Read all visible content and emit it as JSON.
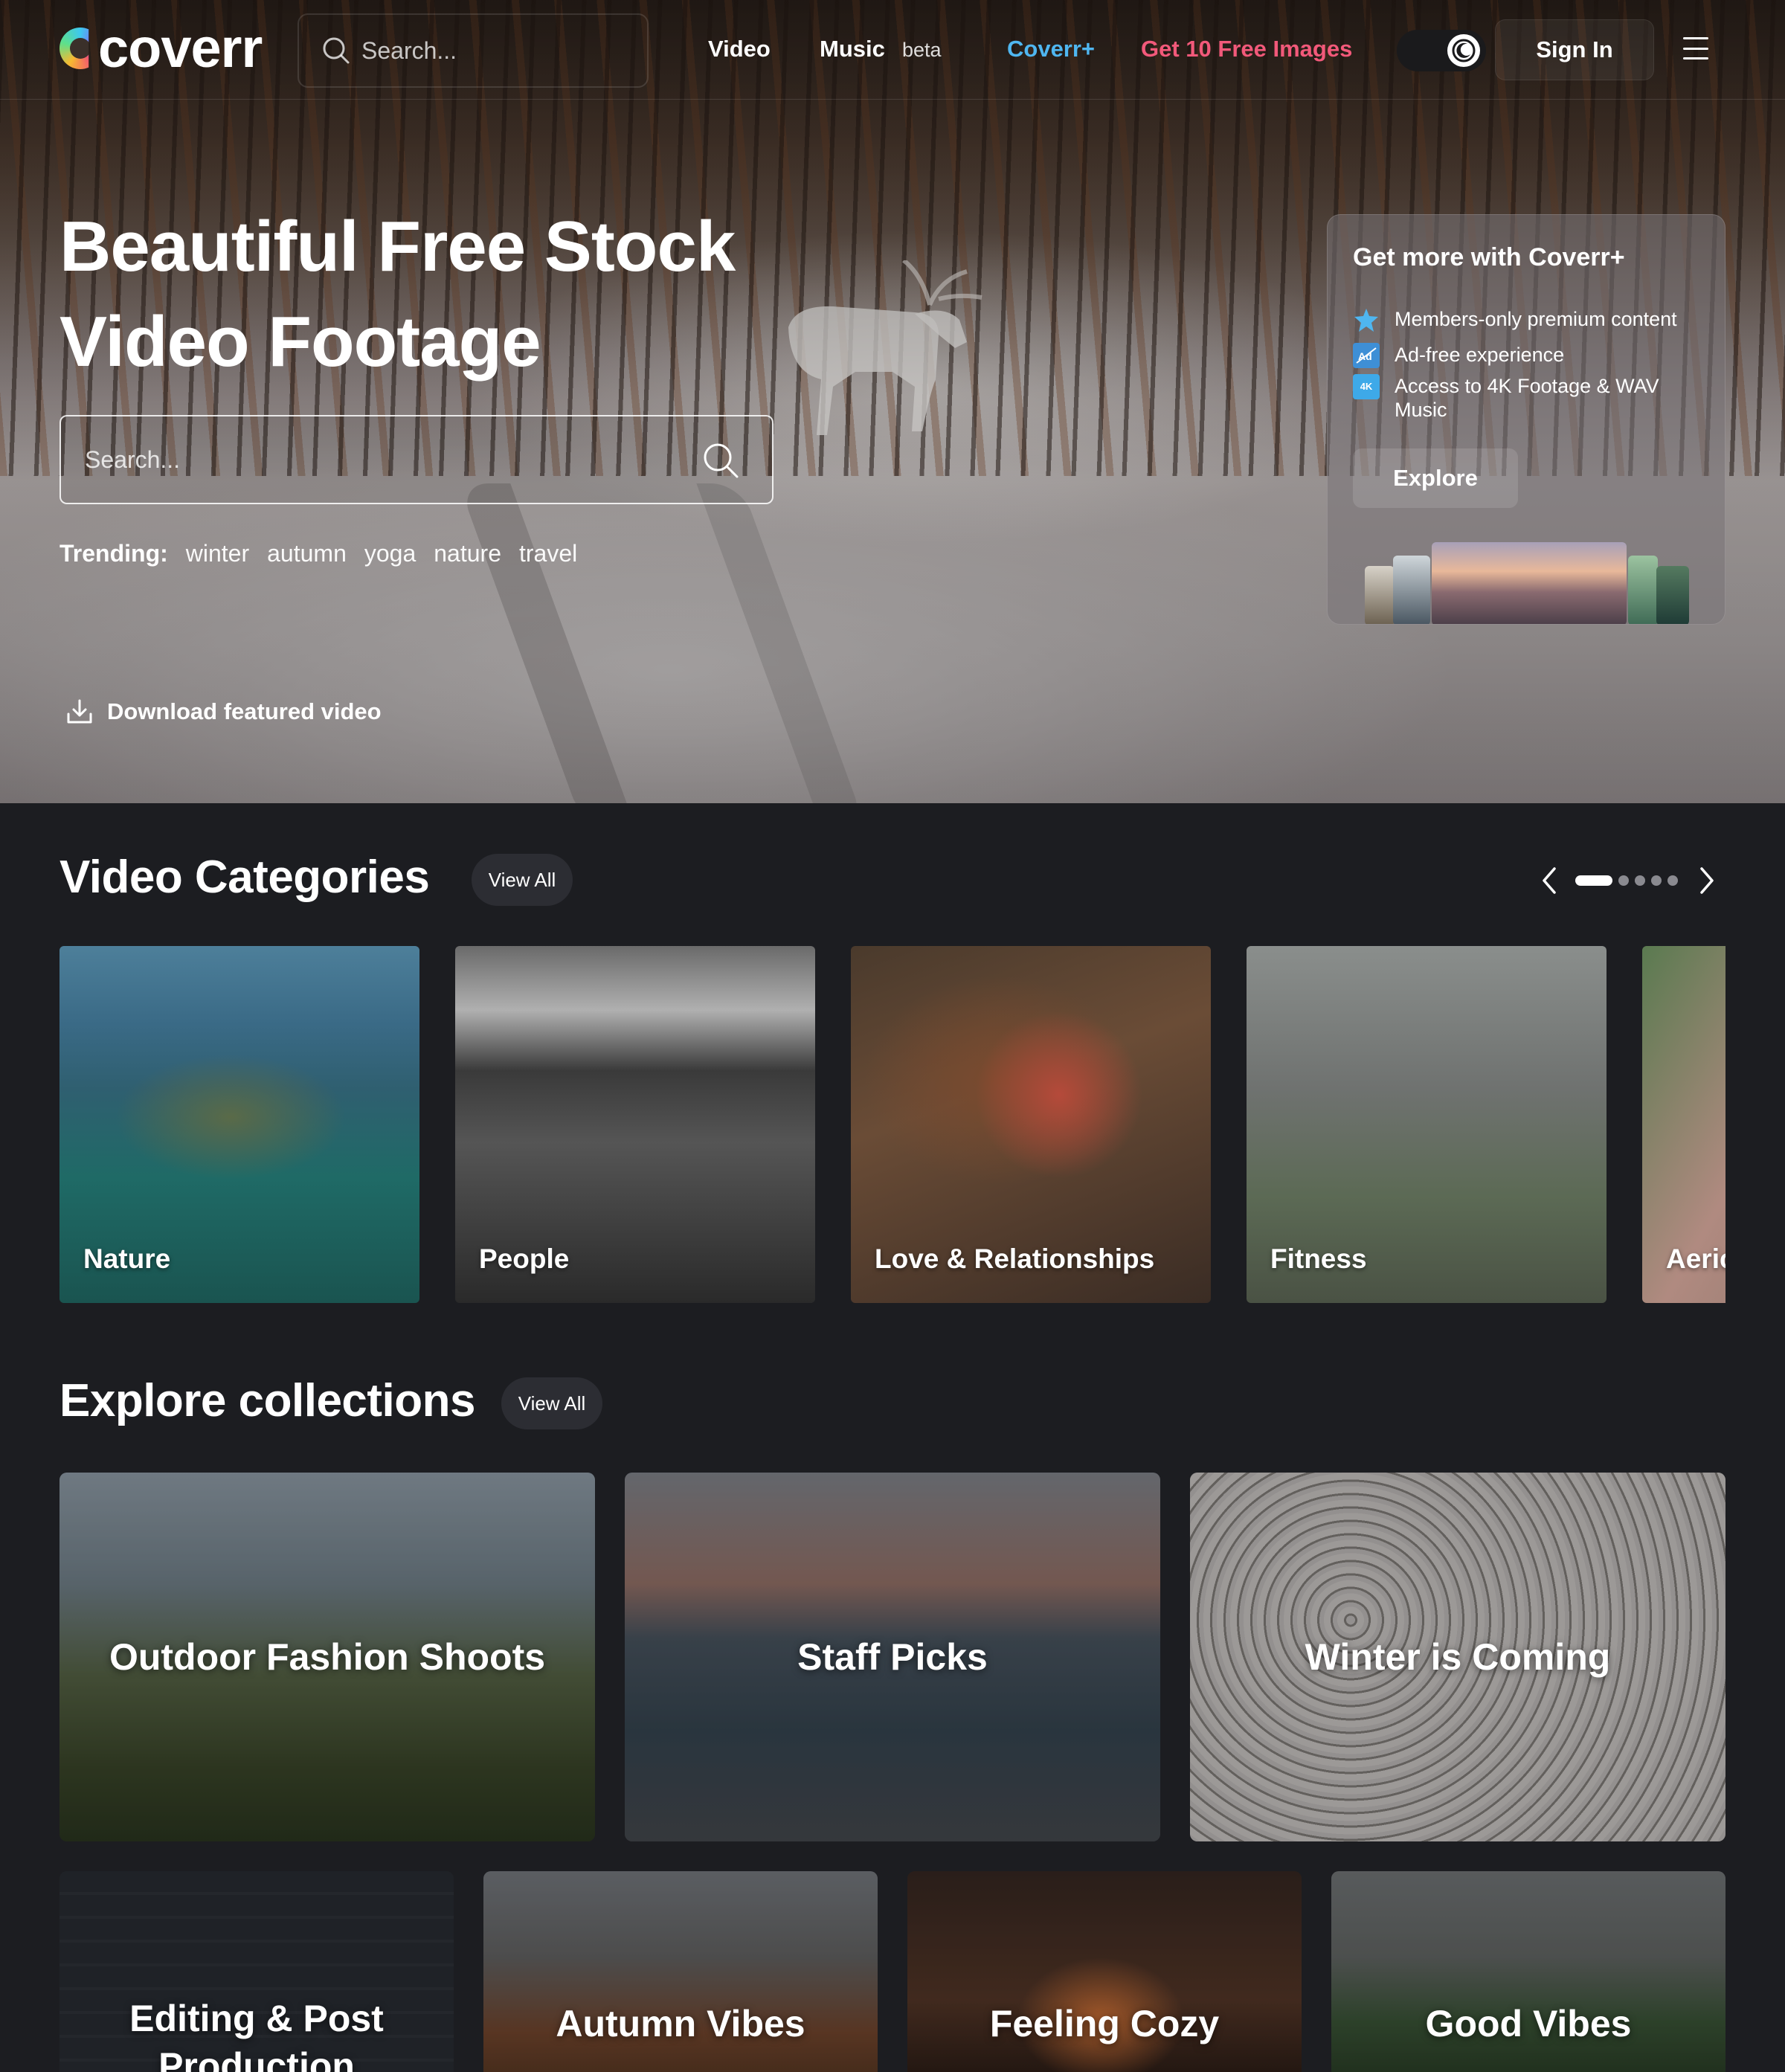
{
  "nav": {
    "logo_text": "coverr",
    "search_placeholder": "Search...",
    "links": {
      "video": "Video",
      "music": "Music",
      "music_badge": "beta",
      "coverr_plus": "Coverr+",
      "free_images": "Get 10 Free Images"
    },
    "sign_in": "Sign In"
  },
  "hero": {
    "title_line1": "Beautiful Free Stock",
    "title_line2": "Video Footage",
    "search_placeholder": "Search...",
    "trending_label": "Trending:",
    "trending_tags": [
      "winter",
      "autumn",
      "yoga",
      "nature",
      "travel"
    ],
    "download_label": "Download featured video"
  },
  "coverr_plus_card": {
    "title": "Get more with Coverr+",
    "features": [
      {
        "icon": "star-badge-icon",
        "label": "Members-only premium content"
      },
      {
        "icon": "ad-free-icon",
        "label": "Ad-free experience"
      },
      {
        "icon": "4k-icon",
        "icon_text": "4K",
        "label": "Access to 4K Footage & WAV Music"
      }
    ],
    "explore_label": "Explore"
  },
  "categories": {
    "title": "Video Categories",
    "view_all": "View All",
    "carousel_pages": 5,
    "carousel_active": 0,
    "items": [
      "Nature",
      "People",
      "Love & Relationships",
      "Fitness",
      "Aeric"
    ]
  },
  "collections": {
    "title": "Explore collections",
    "view_all": "View All",
    "row1": [
      "Outdoor Fashion Shoots",
      "Staff Picks",
      "Winter is Coming"
    ],
    "row2": [
      {
        "line1": "Editing & Post",
        "line2": "Production"
      },
      "Autumn Vibes",
      "Feeling Cozy",
      "Good Vibes"
    ]
  },
  "colors": {
    "page_bg": "#1c1d21",
    "coverr_plus": "#4fb6f0",
    "free_images": "#f2597a",
    "pill_bg": "#2c2d33"
  }
}
